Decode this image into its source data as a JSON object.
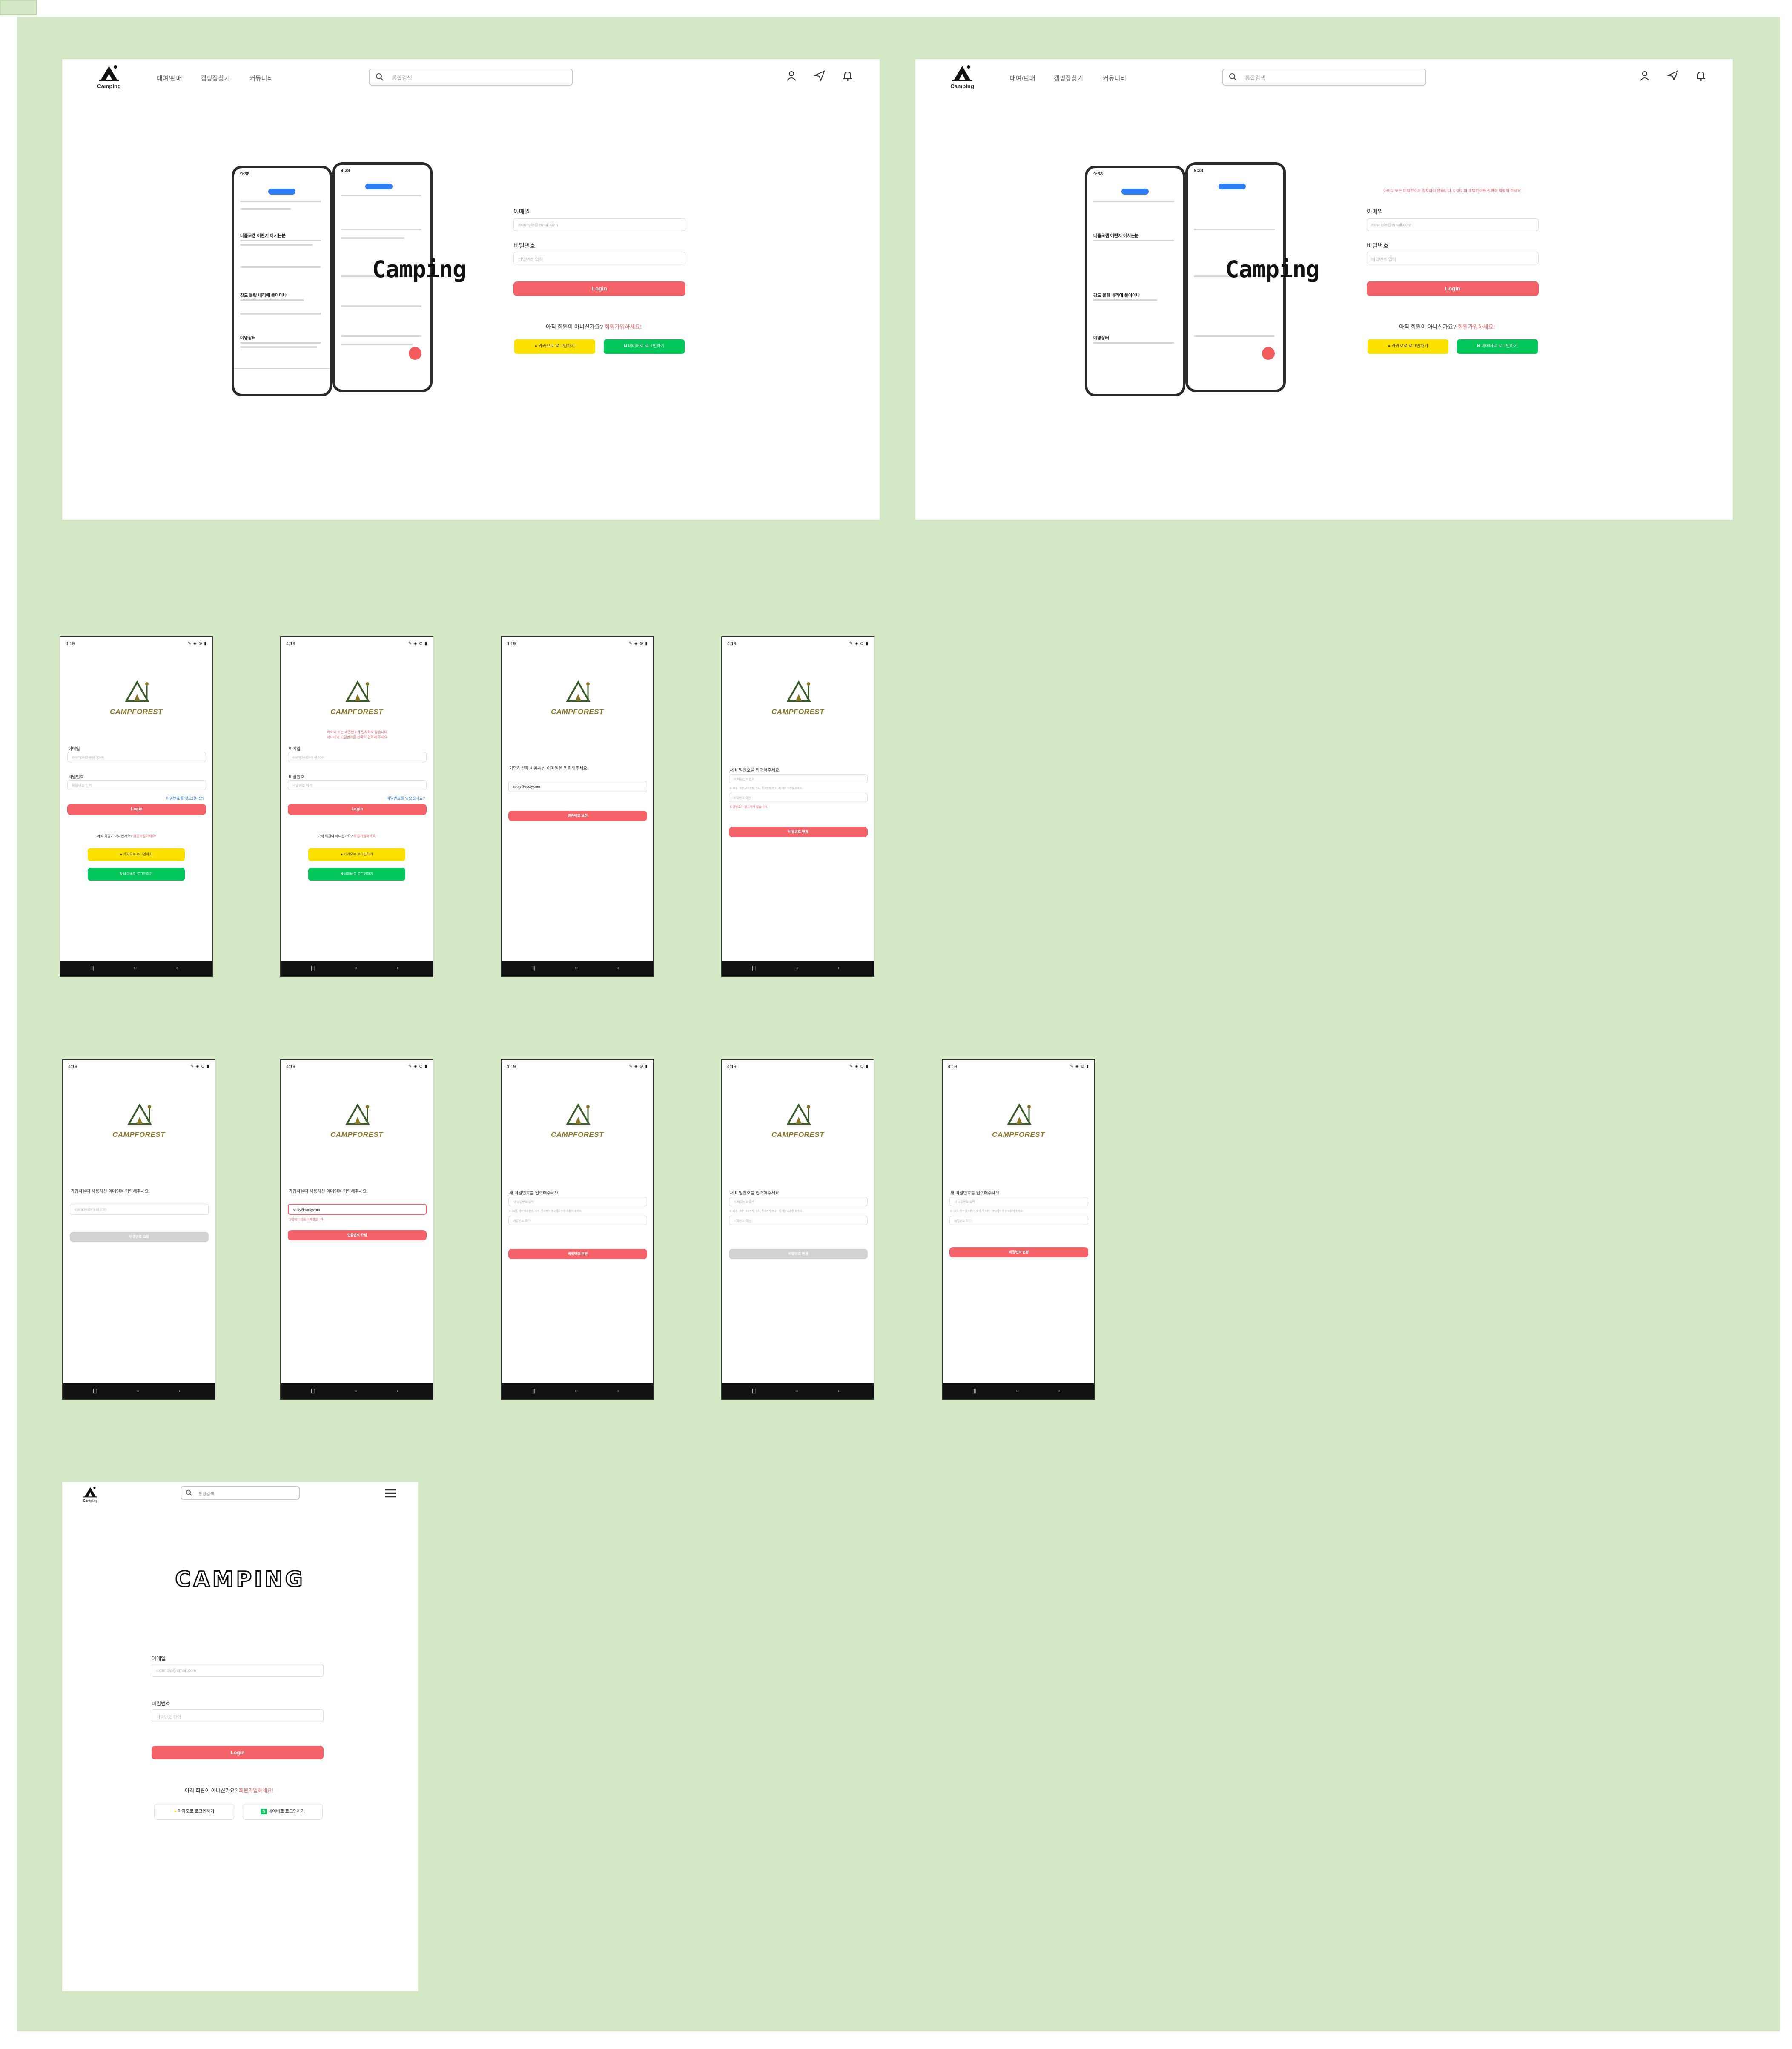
{
  "desktop": {
    "brand": "Camping",
    "nav": [
      "대여/판매",
      "캠핑장찾기",
      "커뮤니티"
    ],
    "search_placeholder": "통합검색",
    "hero_word": "Camping",
    "email_label": "이메일",
    "email_placeholder": "example@email.com",
    "password_label": "비밀번호",
    "password_placeholder": "비밀번호 입력",
    "login_label": "Login",
    "signup_question": "아직 회원이 아니신가요?",
    "signup_link": "회원가입하세요!",
    "kakao_label": "카카오로 로그인하기",
    "naver_label": "네이버로 로그인하기",
    "error_message": "아이디 또는 비밀번호가 일치하지 않습니다. 아이디와 비밀번호를 정확히 입력해 주세요."
  },
  "phone_mock": {
    "time": "9:38",
    "post_titles": [
      "나홀로캠 어떤지 아시는분",
      "강도 물량 내리에 풀이어나",
      "야영장터"
    ]
  },
  "mobile": {
    "time": "4:19",
    "status_icons": "✎ ◈ ⊙ ▮",
    "brand": "CAMPFOREST",
    "email_label": "이메일",
    "email_placeholder": "example@email.com",
    "password_label": "비밀번호",
    "password_placeholder": "비밀번호 입력",
    "find_password": "비밀번호를 잊으셨나요?",
    "login_label": "Login",
    "signup_question": "아직 회원이 아니신가요?",
    "signup_link": "회원가입하세요!",
    "kakao_label": "카카오로 로그인하기",
    "naver_label": "네이버로 로그인하기",
    "error_message_1": "아이디 또는 비밀번호가 일치하지 않습니다.",
    "error_message_2": "아이디와 비밀번호를 정확히 입력해 주세요.",
    "email_prompt": "가입하실때 사용하신 이메일을 입력해주세요.",
    "email_value": "sooty@sooty.com",
    "email_error": "가입되지 않은 이메일입니다.",
    "send_code": "인증번호 요청",
    "new_password_prompt": "새 비밀번호를 입력해주세요",
    "new_password_placeholder": "새 비밀번호 입력",
    "password_rule": "8~16자, 영문 대소문자, 숫자, 특수문자 중 2가지 이상 조합해 주세요.",
    "password_confirm_placeholder": "비밀번호 확인",
    "password_mismatch": "비밀번호가 일치하지 않습니다.",
    "change_password": "비밀번호 변경",
    "nav_recent": "|||",
    "nav_home": "○",
    "nav_back": "‹"
  },
  "tablet": {
    "brand": "Camping",
    "search_placeholder": "통합검색",
    "hero_word": "CAMPING",
    "email_label": "이메일",
    "email_placeholder": "example@email.com",
    "password_label": "비밀번호",
    "password_placeholder": "비밀번호 입력",
    "login_label": "Login",
    "signup_question": "아직 회원이 아니신가요?",
    "signup_link": "회원가입하세요!",
    "kakao_label": "카카오로 로그인하기",
    "naver_label": "네이버로 로그인하기"
  },
  "colors": {
    "board": "#d4e7c5",
    "accent": "#f4626a",
    "kakao": "#fae100",
    "naver": "#03c75a",
    "brand_gold": "#8a7628"
  }
}
